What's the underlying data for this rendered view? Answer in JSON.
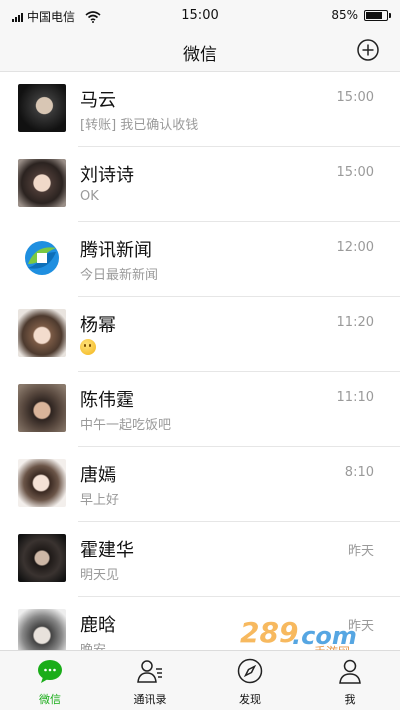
{
  "status_bar": {
    "carrier": "中国电信",
    "time": "15:00",
    "battery_text": "85%",
    "battery_level": 0.85
  },
  "nav": {
    "title": "微信",
    "add_icon": "plus-circle-icon"
  },
  "chats": [
    {
      "name": "马云",
      "preview": "[转账] 我已确认收钱",
      "time": "15:00"
    },
    {
      "name": "刘诗诗",
      "preview": "OK",
      "time": "15:00"
    },
    {
      "name": "腾讯新闻",
      "preview": "今日最新新闻",
      "time": "12:00"
    },
    {
      "name": "杨幂",
      "preview": "",
      "preview_icon": "smiley-emoji-icon",
      "time": "11:20"
    },
    {
      "name": "陈伟霆",
      "preview": "中午一起吃饭吧",
      "time": "11:10"
    },
    {
      "name": "唐嫣",
      "preview": "早上好",
      "time": "8:10"
    },
    {
      "name": "霍建华",
      "preview": "明天见",
      "time": "昨天"
    },
    {
      "name": "鹿晗",
      "preview": "晚安",
      "time": "昨天"
    }
  ],
  "tabs": [
    {
      "label": "微信",
      "icon": "chat-bubble-icon",
      "active": true
    },
    {
      "label": "通讯录",
      "icon": "contacts-icon",
      "active": false
    },
    {
      "label": "发现",
      "icon": "compass-icon",
      "active": false
    },
    {
      "label": "我",
      "icon": "person-icon",
      "active": false
    }
  ],
  "watermark": {
    "text": "手游网"
  },
  "colors": {
    "accent": "#1aad19",
    "bar_bg": "#f7f7f7",
    "secondary_text": "#9a9a9a"
  }
}
